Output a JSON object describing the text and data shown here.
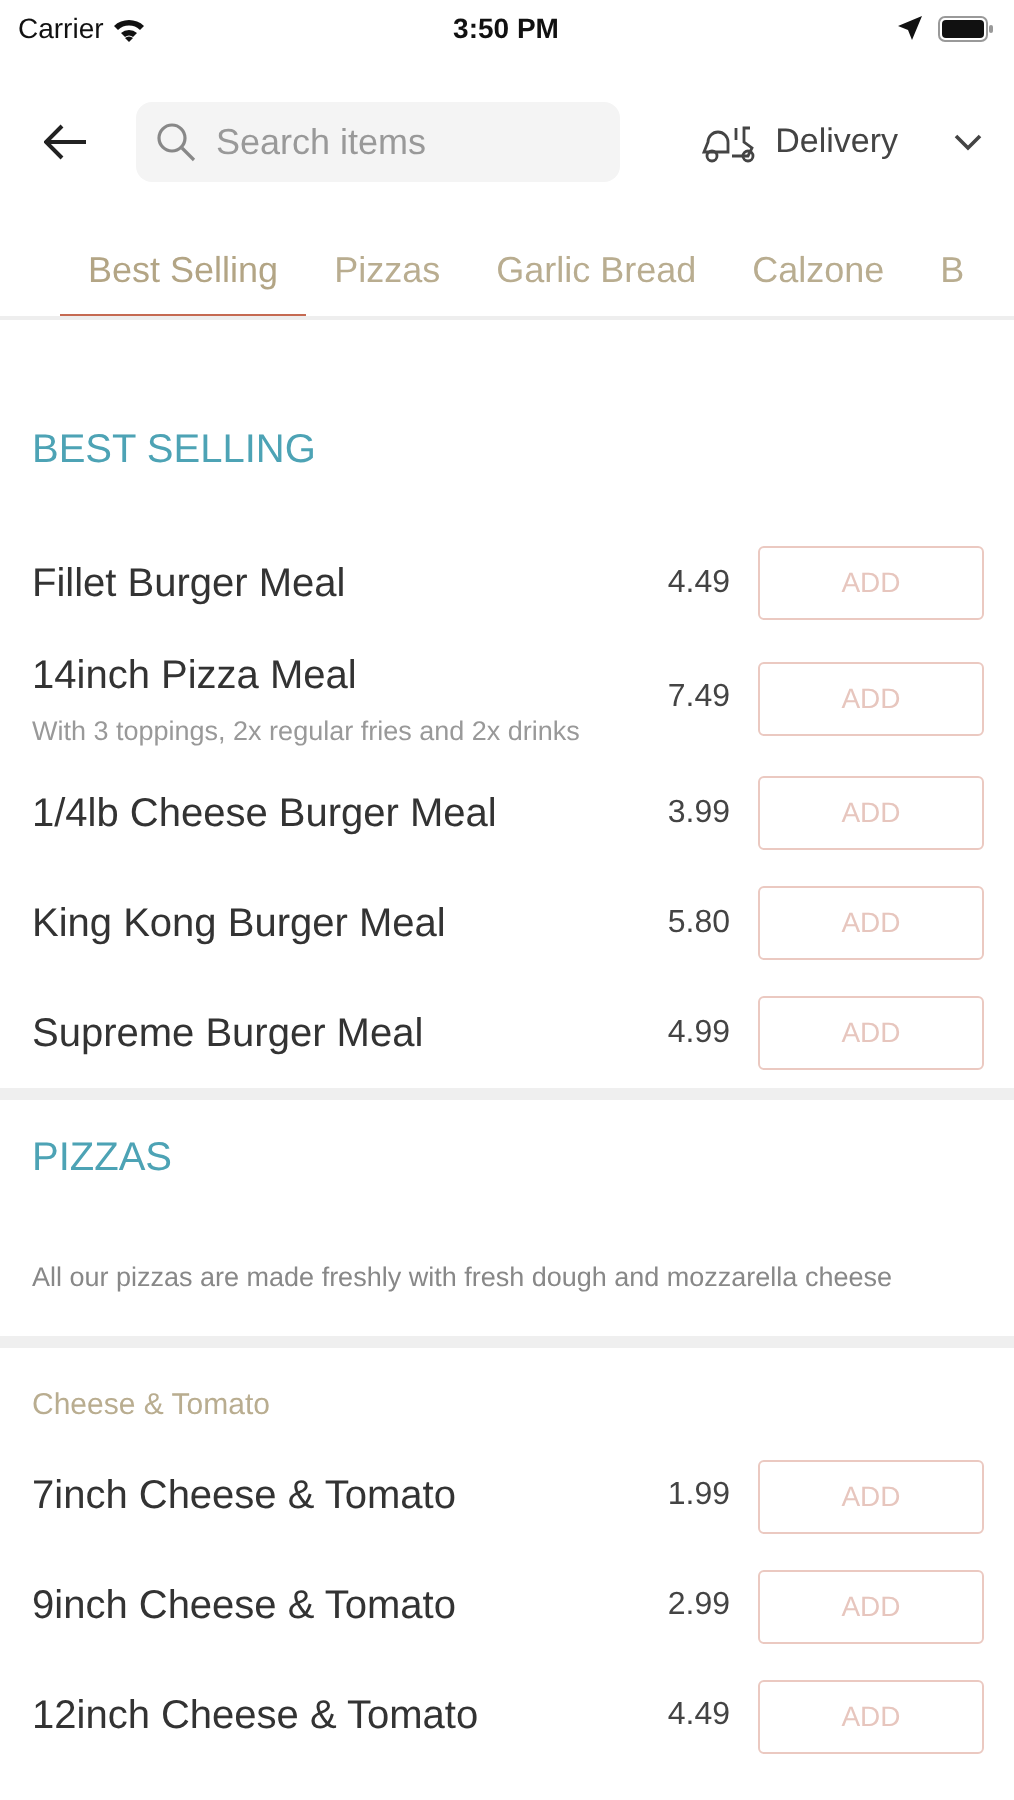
{
  "status_bar": {
    "carrier": "Carrier",
    "time": "3:50 PM"
  },
  "header": {
    "search": {
      "placeholder": "Search items"
    },
    "delivery": {
      "label": "Delivery"
    }
  },
  "tabs": [
    {
      "label": "Best Selling",
      "selected": true
    },
    {
      "label": "Pizzas",
      "selected": false
    },
    {
      "label": "Garlic Bread",
      "selected": false
    },
    {
      "label": "Calzone",
      "selected": false
    },
    {
      "label": "B",
      "selected": false
    }
  ],
  "sections": [
    {
      "title": "BEST SELLING",
      "groups": [
        {
          "items": [
            {
              "name": "Fillet Burger Meal",
              "price": "4.49",
              "button": "ADD"
            },
            {
              "name": "14inch Pizza Meal",
              "description": "With 3 toppings, 2x regular fries and 2x drinks",
              "price": "7.49",
              "button": "ADD"
            },
            {
              "name": "1/4lb Cheese Burger Meal",
              "price": "3.99",
              "button": "ADD"
            },
            {
              "name": "King Kong Burger Meal",
              "price": "5.80",
              "button": "ADD"
            },
            {
              "name": "Supreme Burger Meal",
              "price": "4.99",
              "button": "ADD"
            }
          ]
        }
      ]
    },
    {
      "title": "PIZZAS",
      "description": "All our pizzas are made freshly with fresh dough and mozzarella cheese",
      "groups": [
        {
          "title": "Cheese & Tomato",
          "items": [
            {
              "name": "7inch Cheese & Tomato",
              "price": "1.99",
              "button": "ADD"
            },
            {
              "name": "9inch Cheese & Tomato",
              "price": "2.99",
              "button": "ADD"
            },
            {
              "name": "12inch Cheese & Tomato",
              "price": "4.49",
              "button": "ADD"
            }
          ]
        }
      ]
    }
  ]
}
